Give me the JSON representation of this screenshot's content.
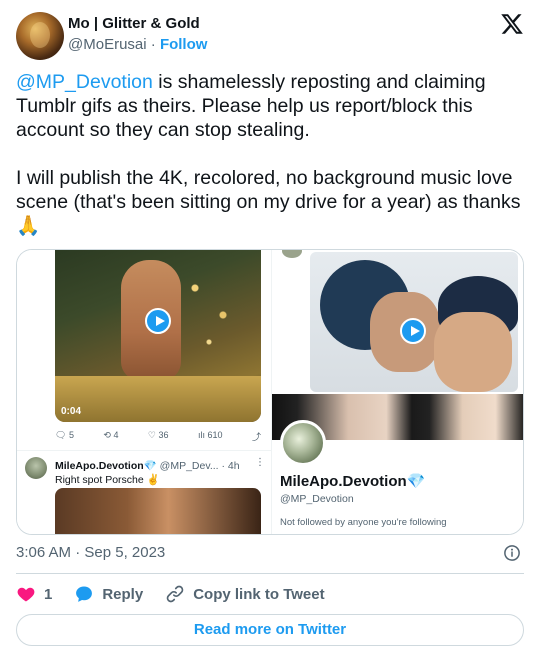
{
  "author": {
    "name": "Mo | Glitter & Gold",
    "handle": "@MoErusai",
    "separator": "·",
    "follow_label": "Follow"
  },
  "tweet": {
    "mention": "@MP_Devotion",
    "line1_rest": " is shamelessly reposting and claiming Tumblr gifs as theirs. Please help us report/block this account so they can stop stealing.",
    "line2": "I will publish the 4K, recolored, no background music love scene (that's been sitting on my drive for a year) as thanks ",
    "emoji": "🙏"
  },
  "media": {
    "left_video": {
      "duration": "0:04",
      "stats": {
        "replies": "5",
        "retweets": "4",
        "likes": "36",
        "views": "610"
      },
      "reply_name": "MileApo.Devotion💎",
      "reply_handle": "@MP_Dev...",
      "reply_time": "· 4h",
      "reply_dots": "⋮",
      "reply_text": "Right spot Porsche ✌️"
    },
    "profile": {
      "name": "MileApo.Devotion💎",
      "handle": "@MP_Devotion",
      "note": "Not followed by anyone you're following"
    }
  },
  "timestamp": "3:06 AM · Sep 5, 2023",
  "actions": {
    "like_count": "1",
    "reply_label": "Reply",
    "copy_label": "Copy link to Tweet"
  },
  "read_more": "Read more on Twitter",
  "colors": {
    "accent": "#1d9bf0",
    "like": "#f91880",
    "text": "#0f1419",
    "muted": "#536471",
    "border": "#cfd9de"
  },
  "icons": {
    "brand": "x-logo-icon",
    "info": "info-icon",
    "like": "heart-icon",
    "reply": "speech-bubble-icon",
    "copy": "link-icon"
  }
}
